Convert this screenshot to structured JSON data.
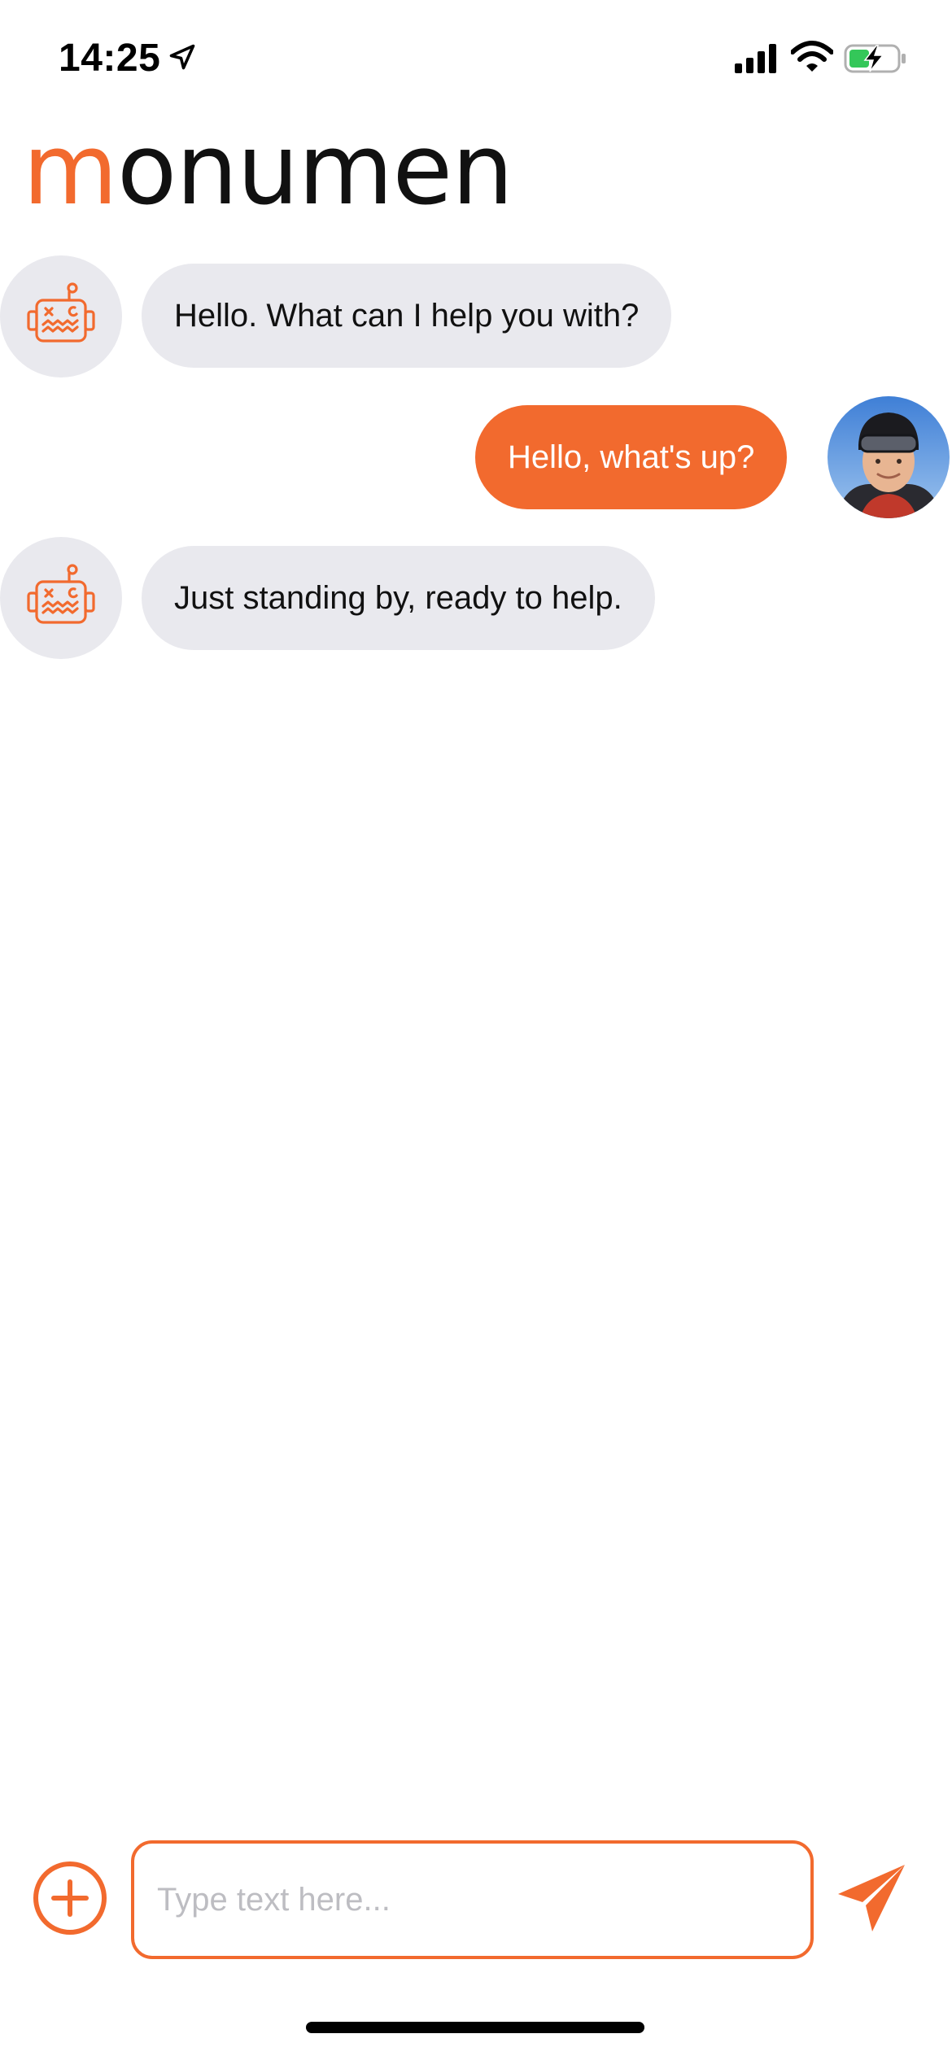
{
  "status_bar": {
    "time": "14:25",
    "icons": [
      "location-arrow-icon",
      "cellular-signal-icon",
      "wifi-icon",
      "battery-charging-icon"
    ],
    "battery_color": "#34c759"
  },
  "app": {
    "logo_accent": "m",
    "logo_rest": "onumen",
    "accent_color": "#f26a2e"
  },
  "messages": [
    {
      "sender": "bot",
      "text": "Hello. What can I help you with?"
    },
    {
      "sender": "user",
      "text": "Hello, what's up?"
    },
    {
      "sender": "bot",
      "text": "Just standing by, ready to help."
    }
  ],
  "composer": {
    "placeholder": "Type text here...",
    "value": "",
    "add_icon": "plus-circle-icon",
    "send_icon": "paper-plane-icon"
  }
}
